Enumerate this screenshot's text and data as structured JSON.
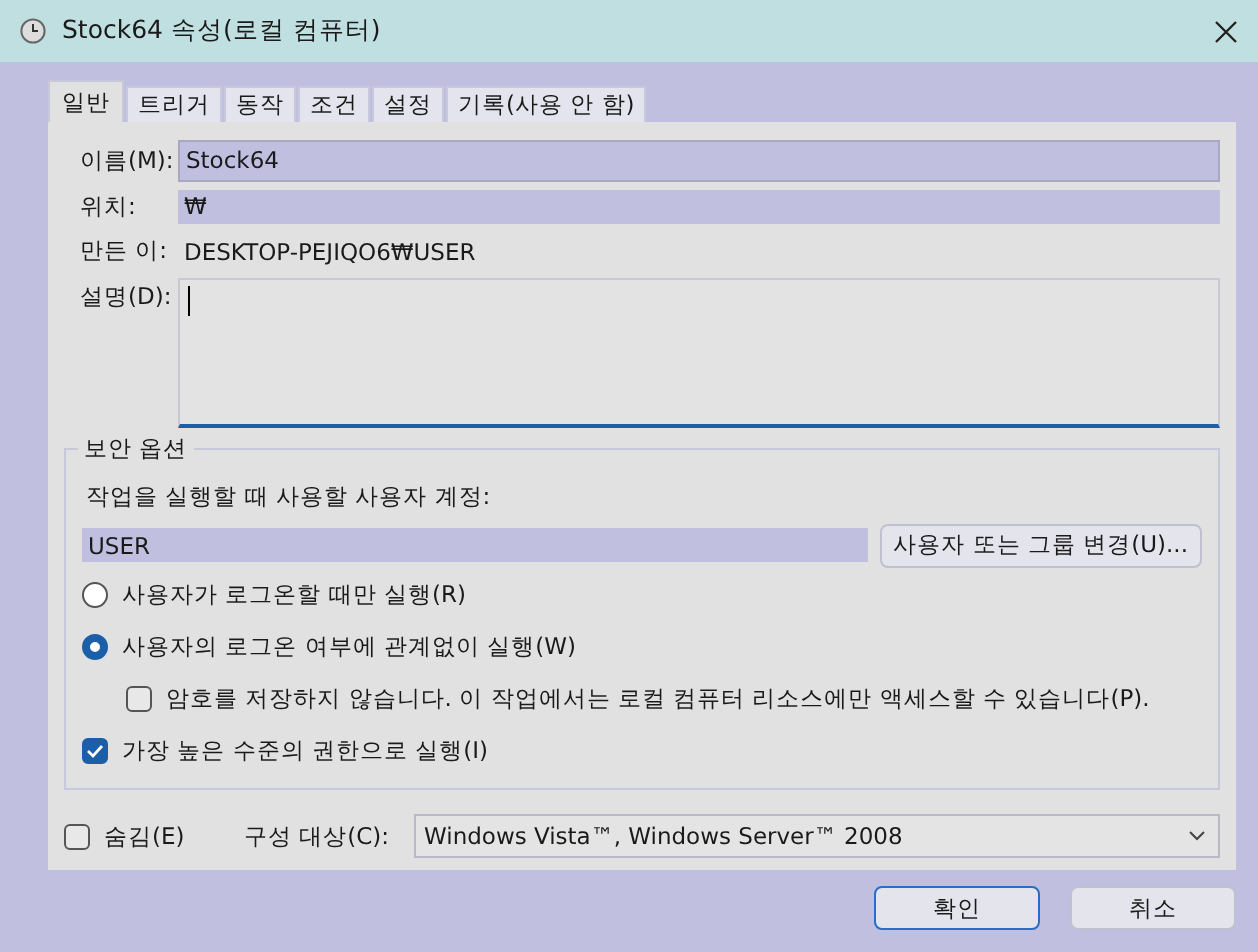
{
  "window": {
    "title": "Stock64 속성(로컬 컴퓨터)"
  },
  "tabs": [
    {
      "label": "일반",
      "selected": true
    },
    {
      "label": "트리거",
      "selected": false
    },
    {
      "label": "동작",
      "selected": false
    },
    {
      "label": "조건",
      "selected": false
    },
    {
      "label": "설정",
      "selected": false
    },
    {
      "label": "기록(사용 안 함)",
      "selected": false
    }
  ],
  "name": {
    "label": "이름(M):",
    "value": "Stock64"
  },
  "location": {
    "label": "위치:",
    "value": "₩"
  },
  "author": {
    "label": "만든 이:",
    "value": "DESKTOP-PEJIQO6₩USER"
  },
  "description": {
    "label": "설명(D):"
  },
  "security": {
    "title": "보안 옵션",
    "account_label": "작업을 실행할 때 사용할 사용자 계정:",
    "account": "USER",
    "change_button": "사용자 또는 그룹 변경(U)...",
    "options": [
      {
        "kind": "radio",
        "label": "사용자가 로그온할 때만 실행(R)",
        "selected": false,
        "indent": false
      },
      {
        "kind": "radio",
        "label": "사용자의 로그온 여부에 관계없이 실행(W)",
        "selected": true,
        "indent": false
      },
      {
        "kind": "checkbox",
        "label": "암호를 저장하지 않습니다. 이 작업에서는 로컬 컴퓨터 리소스에만 액세스할 수 있습니다(P).",
        "checked": false,
        "indent": true
      },
      {
        "kind": "checkbox",
        "label": "가장 높은 수준의 권한으로 실행(I)",
        "checked": true,
        "indent": false
      }
    ]
  },
  "hidden": {
    "label": "숨김(E)",
    "checked": false
  },
  "configure": {
    "label": "구성 대상(C):",
    "value": "Windows Vista™, Windows Server™ 2008"
  },
  "buttons": [
    "확인",
    "취소"
  ]
}
